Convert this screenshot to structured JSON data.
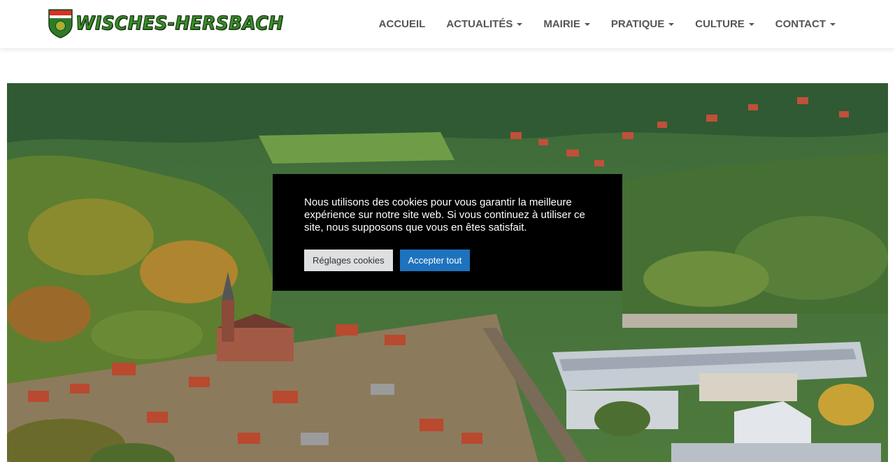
{
  "header": {
    "brand_name": "WISCHES-HERSBACH",
    "nav": [
      {
        "label": "ACCUEIL",
        "dropdown": false
      },
      {
        "label": "ACTUALITÉS",
        "dropdown": true
      },
      {
        "label": "MAIRIE",
        "dropdown": true
      },
      {
        "label": "PRATIQUE",
        "dropdown": true
      },
      {
        "label": "CULTURE",
        "dropdown": true
      },
      {
        "label": "CONTACT",
        "dropdown": true
      }
    ]
  },
  "cookie_banner": {
    "message": "Nous utilisons des cookies pour vous garantir la meilleure expérience sur notre site web. Si vous continuez à utiliser ce site, nous supposons que vous en êtes satisfait.",
    "settings_label": "Réglages cookies",
    "accept_label": "Accepter tout"
  },
  "colors": {
    "brand_green": "#3c8b2c",
    "accept_blue": "#1e73be",
    "nav_text": "#555555"
  },
  "icons": {
    "brand": "shield-coat-of-arms-icon",
    "dropdown": "caret-down-icon"
  }
}
